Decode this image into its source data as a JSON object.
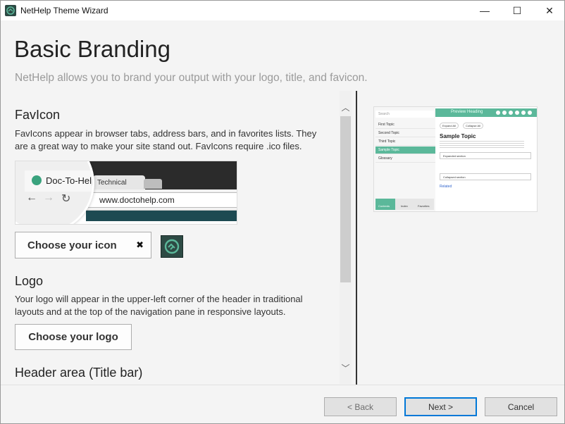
{
  "window": {
    "title": "NetHelp Theme Wizard",
    "controls": {
      "minimize": "—",
      "maximize": "☐",
      "close": "✕"
    }
  },
  "page": {
    "heading": "Basic Branding",
    "subheading": "NetHelp allows you to brand your output with your logo, title, and favicon."
  },
  "favicon": {
    "title": "FavIcon",
    "description": "FavIcons appear in browser tabs, address bars, and in favorites lists. They are a great way to make your site stand out. FavIcons require .ico files.",
    "sample": {
      "tab_label": "Doc-To-Help",
      "second_tab": "Technical",
      "url": "www.doctohelp.com"
    },
    "choose_button": "Choose your icon",
    "clear_icon": "✖"
  },
  "logo": {
    "title": "Logo",
    "description": "Your logo will appear in the upper-left corner of the header in traditional layouts and at the top of the navigation pane in responsive layouts.",
    "choose_button": "Choose your logo"
  },
  "header_area": {
    "title": "Header area (Title bar)"
  },
  "preview": {
    "search": "Search",
    "header_title": "Preview Heading",
    "toc": [
      "First Topic",
      "Second Topic",
      "Third Topic",
      "Sample Topic",
      "Glossary"
    ],
    "active_index": 3,
    "topic_title": "Sample Topic",
    "expand_all": "Expand All",
    "collapse_all": "Collapse All",
    "footer_tabs": [
      "Contents",
      "Index",
      "Favorites"
    ],
    "sections": [
      "Expanded section",
      "Collapsed section"
    ],
    "links_title": "Related",
    "accent_color": "#5bb89a"
  },
  "footer": {
    "back": "< Back",
    "next": "Next >",
    "cancel": "Cancel"
  }
}
